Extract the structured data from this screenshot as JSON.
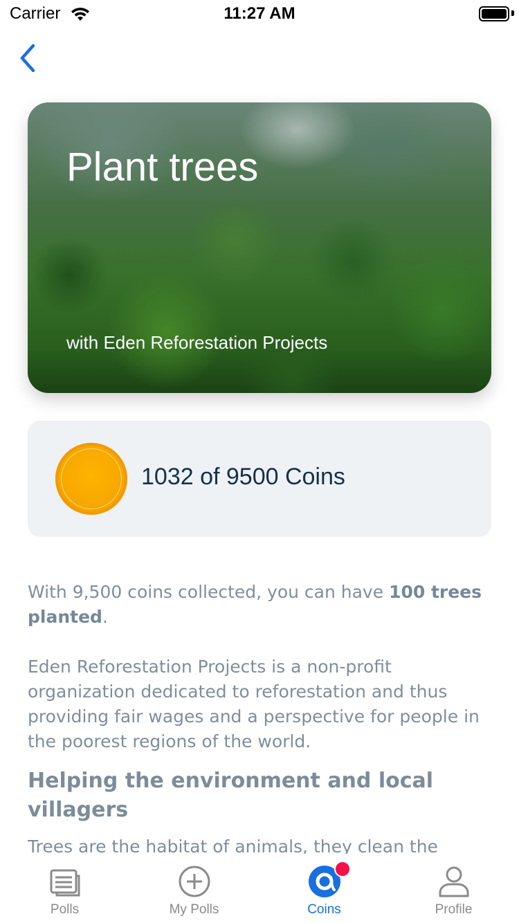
{
  "status_bar": {
    "carrier": "Carrier",
    "time": "11:27 AM"
  },
  "hero": {
    "title": "Plant trees",
    "subtitle": "with Eden Reforestation Projects"
  },
  "coins": {
    "text": "1032 of 9500 Coins",
    "collected": 1032,
    "goal": 9500
  },
  "description": {
    "p1_start": "With 9,500 coins collected, you can have ",
    "p1_bold": "100 trees planted",
    "p1_end": ".",
    "p2": "Eden Reforestation Projects is a non-profit organization dedicated to reforestation and thus providing fair wages and a perspective for people in the poorest regions of the world."
  },
  "section": {
    "heading": "Helping the environment and local villagers",
    "text": "Trees are the habitat of animals, they clean the"
  },
  "tabs": [
    {
      "label": "Polls",
      "icon": "polls-icon"
    },
    {
      "label": "My Polls",
      "icon": "plus-circle-icon"
    },
    {
      "label": "Coins",
      "icon": "coins-icon",
      "active": true
    },
    {
      "label": "Profile",
      "icon": "profile-icon"
    }
  ],
  "colors": {
    "accent": "#1a6fe0",
    "badge": "#f5104a",
    "coin": "#f7a800"
  }
}
